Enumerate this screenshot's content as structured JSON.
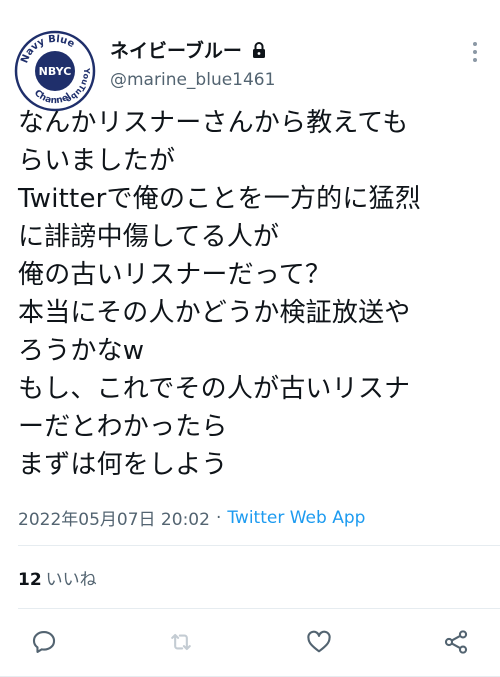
{
  "tweet": {
    "author": {
      "display_name": "ネイビーブルー",
      "handle": "@marine_blue1461",
      "avatar_text_top": "Navy Blue",
      "avatar_text_right": "YouTube",
      "avatar_text_bottom": "Channel",
      "avatar_center": "NBYC",
      "protected_icon": "lock-icon"
    },
    "text": "なんかリスナーさんから教えても\nらいましたが\nTwitterで俺のことを一方的に猛烈\nに誹謗中傷してる人が\n俺の古いリスナーだって？\n本当にその人かどうか検証放送や\nろうかなw\nもし、これでその人が古いリスナ\nーだとわかったら\nまずは何をしよう",
    "timestamp": "2022年05月07日 20:02",
    "separator": "·",
    "source_app": "Twitter Web App",
    "likes_count": "12",
    "likes_label": "いいね"
  },
  "actions": [
    "reply-icon",
    "retweet-icon",
    "like-icon",
    "share-icon"
  ],
  "colors": {
    "accent": "#1d9bf0",
    "secondary_text": "#536471",
    "avatar_navy": "#1f2f6b"
  }
}
